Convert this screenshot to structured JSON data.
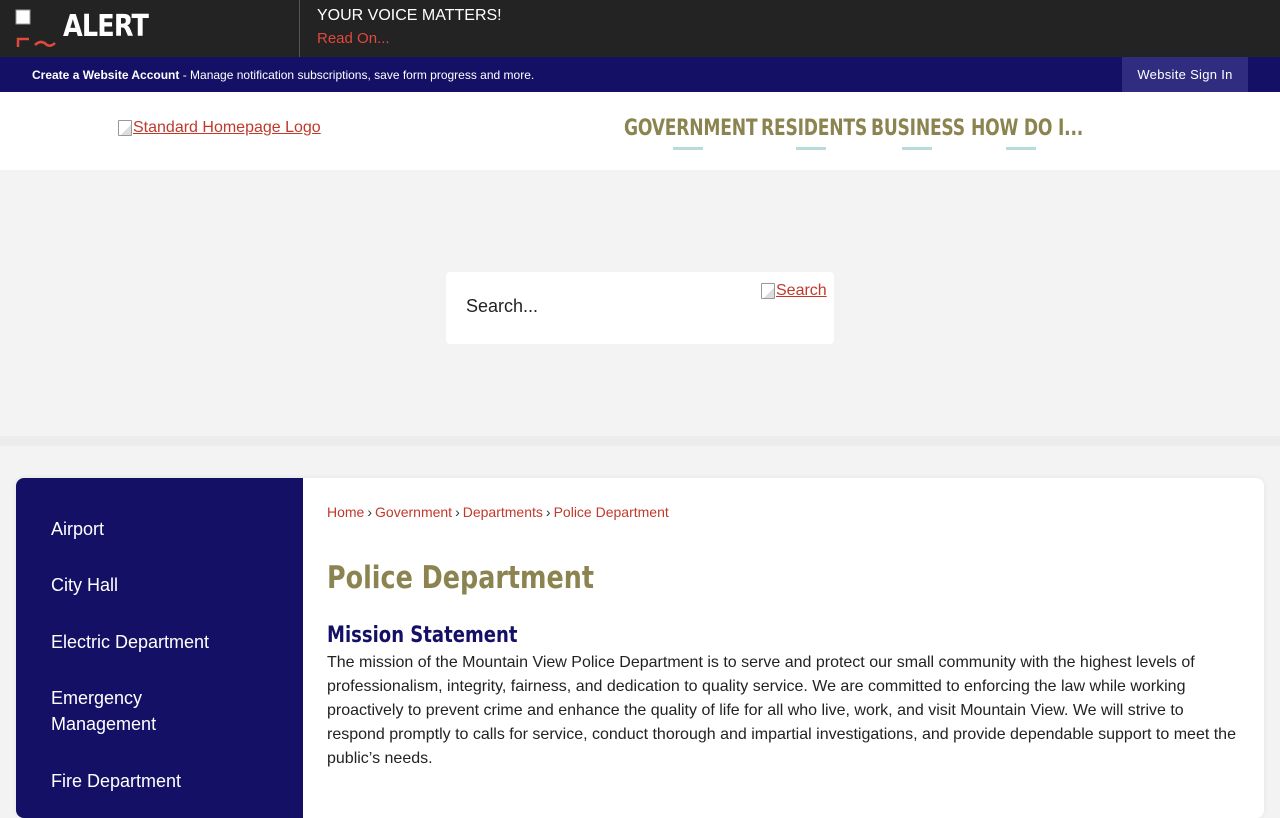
{
  "alert": {
    "title": "ALERT",
    "message": "YOUR VOICE MATTERS!",
    "link": "Read On..."
  },
  "account": {
    "create_label": "Create a Website Account",
    "description": " - Manage notification subscriptions, save form progress and more.",
    "signin_label": "Website Sign In"
  },
  "header": {
    "logo_alt": "Standard Homepage Logo",
    "nav": [
      "GOVERNMENT",
      "RESIDENTS",
      "BUSINESS",
      "HOW DO I..."
    ]
  },
  "search": {
    "placeholder": "Search...",
    "button_alt": "Search"
  },
  "sidebar": {
    "items": [
      "Airport",
      "City Hall",
      "Electric Department",
      "Emergency Management",
      "Fire Department"
    ]
  },
  "breadcrumb": [
    "Home",
    "Government",
    "Departments",
    "Police Department"
  ],
  "main": {
    "title": "Police Department",
    "mission_heading": "Mission Statement",
    "mission_text": "The mission of the Mountain View Police Department is to serve and protect our small community with the highest levels of professionalism, integrity, fairness, and dedication to quality service. We are committed to enforcing the law while working proactively to prevent crime and enhance the quality of life for all who live, work, and visit Mountain View. We will strive to respond promptly to calls for service, conduct thorough and impartial investigations, and provide dependable support to meet the public’s needs."
  },
  "colors": {
    "alert_bg": "#232323",
    "account_bg": "#141065",
    "nav_text": "#8b8450",
    "link": "#c0392b",
    "heading": "#141065"
  }
}
